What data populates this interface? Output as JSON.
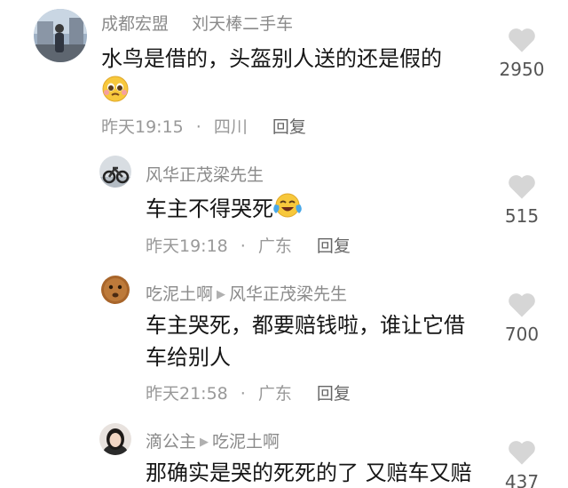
{
  "comments": [
    {
      "username": "成都宏盟",
      "tag": "刘天棒二手车",
      "text": "水鸟是借的，头盔别人送的还是假的",
      "emoji": "pleading-face-emoji",
      "time": "昨天19:15",
      "location": "四川",
      "reply_label": "回复",
      "likes": "2950"
    },
    {
      "username": "风华正茂梁先生",
      "text": "车主不得哭死",
      "emoji": "crying-laughing-emoji",
      "time": "昨天19:18",
      "location": "广东",
      "reply_label": "回复",
      "likes": "515"
    },
    {
      "username": "吃泥土啊",
      "reply_to": "风华正茂梁先生",
      "text_line1": "车主哭死，都要赔钱啦，谁让它借",
      "text_line2": "车给别人",
      "time": "昨天21:58",
      "location": "广东",
      "reply_label": "回复",
      "likes": "700"
    },
    {
      "username": "滴公主",
      "reply_to": "吃泥土啊",
      "text": "那确实是哭的死死的了 又赔车又赔",
      "likes": "437"
    }
  ],
  "icons": {
    "like": "heart-icon",
    "reply_arrow": "caret-right-icon"
  },
  "colors": {
    "username": "#8a8a8a",
    "text": "#161616",
    "meta": "#999999",
    "heart": "#d6d6d6"
  }
}
